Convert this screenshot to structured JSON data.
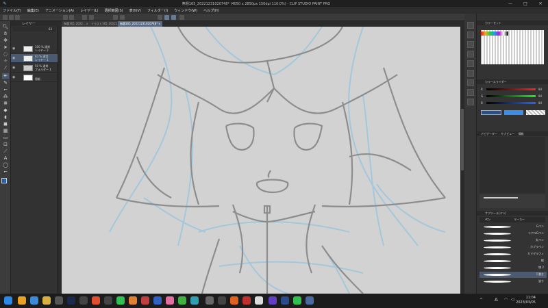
{
  "window": {
    "title": "無題165_20221231020748* (4050 x 2850px 150dpi 110.0%) - CLIP STUDIO PAINT PRO"
  },
  "menu": [
    "ファイル(F)",
    "編集(E)",
    "アニメーション(A)",
    "レイヤー(L)",
    "選択範囲(S)",
    "表示(V)",
    "フィルター(I)",
    "ウィンドウ(W)",
    "ヘルプ(H)"
  ],
  "doc_tabs": [
    {
      "label": "無題165_2022... x"
    },
    {
      "label": "イラスト165_20221... x"
    },
    {
      "label": "無題165_20221231020748* x",
      "active": true
    }
  ],
  "layer_panel": {
    "title": "レイヤー",
    "opacity": "63",
    "layers": [
      {
        "line1": "100 % 通常",
        "line2": "レイヤー 2"
      },
      {
        "line1": "63 % 通常",
        "line2": "レイヤー 1",
        "selected": true
      },
      {
        "line1": "50 % 通常",
        "line2": "フォルダー 1"
      },
      {
        "line1": "",
        "line2": "用紙"
      }
    ]
  },
  "color_set": {
    "title": "カラーセット"
  },
  "color_slider": {
    "title": "カラースライダー",
    "channels": [
      {
        "label": "R",
        "value": "84",
        "color": "#d04040"
      },
      {
        "label": "G",
        "value": "84",
        "color": "#40c040"
      },
      {
        "label": "B",
        "value": "84",
        "color": "#4060e0"
      }
    ]
  },
  "navigator": {
    "tabs": [
      "ナビゲーター",
      "サブビュー",
      "情報"
    ]
  },
  "sub_tool": {
    "title": "サブツール[ペン]",
    "tabs": [
      "ペン",
      "マーカー"
    ],
    "brushes": [
      "Gペン",
      "リアルGペン",
      "丸ペン",
      "カブラペン",
      "カリグラフィ",
      "線",
      "線 2",
      "下書き",
      "塗り"
    ],
    "selected_brush": 7
  },
  "taskbar": {
    "time": "11:04",
    "date": "2023/03/05",
    "ime": "A"
  }
}
